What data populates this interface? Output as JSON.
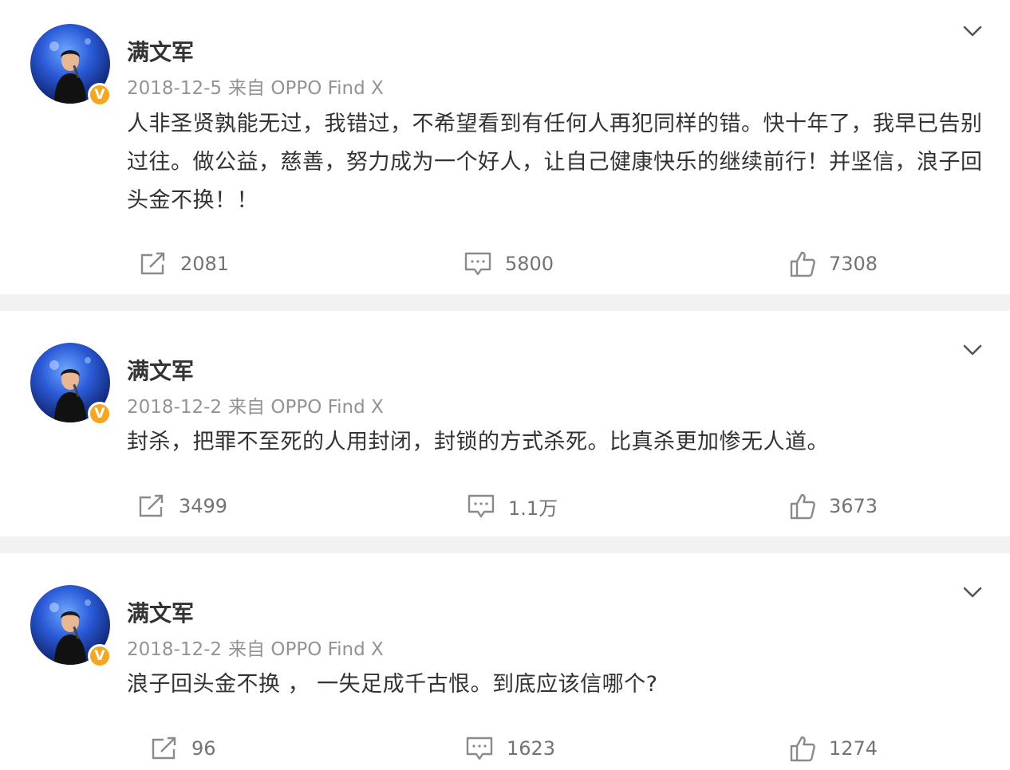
{
  "posts": [
    {
      "author": "满文军",
      "verified_badge": "V",
      "date": "2018-12-5",
      "source": "来自 OPPO Find X",
      "content": "人非圣贤孰能无过，我错过，不希望看到有任何人再犯同样的错。快十年了，我早已告别过往。做公益，慈善，努力成为一个好人，让自己健康快乐的继续前行！并坚信，浪子回头金不换！！",
      "reposts": "2081",
      "comments": "5800",
      "likes": "7308"
    },
    {
      "author": "满文军",
      "verified_badge": "V",
      "date": "2018-12-2",
      "source": "来自 OPPO Find X",
      "content": "封杀，把罪不至死的人用封闭，封锁的方式杀死。比真杀更加惨无人道。",
      "reposts": "3499",
      "comments": "1.1万",
      "likes": "3673"
    },
    {
      "author": "满文军",
      "verified_badge": "V",
      "date": "2018-12-2",
      "source": "来自 OPPO Find X",
      "content": "浪子回头金不换 ， 一失足成千古恨。到底应该信哪个?",
      "reposts": "96",
      "comments": "1623",
      "likes": "1274"
    }
  ],
  "icons": {
    "repost": "repost-icon",
    "comment": "comment-icon",
    "like": "thumbs-up-icon",
    "menu": "chevron-down-icon"
  },
  "colors": {
    "text": "#333333",
    "meta": "#939393",
    "action": "#737373",
    "badge": "#f5a623",
    "separator": "#f2f2f2"
  }
}
